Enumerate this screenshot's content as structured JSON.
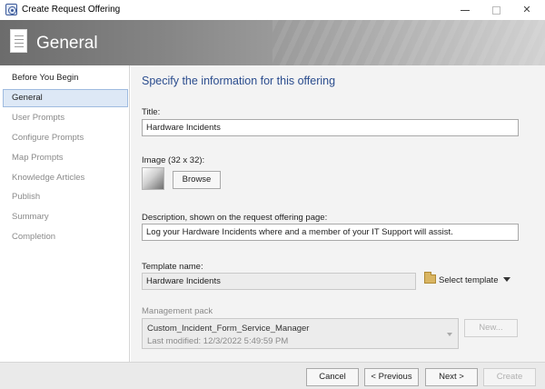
{
  "window": {
    "title": "Create Request Offering",
    "minimize_label": "—",
    "close_label": "✕"
  },
  "header": {
    "title": "General"
  },
  "sidebar": {
    "items": [
      {
        "label": "Before You Begin"
      },
      {
        "label": "General"
      },
      {
        "label": "User Prompts"
      },
      {
        "label": "Configure Prompts"
      },
      {
        "label": "Map Prompts"
      },
      {
        "label": "Knowledge Articles"
      },
      {
        "label": "Publish"
      },
      {
        "label": "Summary"
      },
      {
        "label": "Completion"
      }
    ],
    "active_index": 1
  },
  "main": {
    "section_title": "Specify the information for this offering",
    "title_label": "Title:",
    "title_value": "Hardware Incidents",
    "image_label": "Image (32 x 32):",
    "browse_label": "Browse",
    "description_label": "Description, shown on the request offering page:",
    "description_value": "Log your Hardware Incidents where and a member of your IT Support will assist.",
    "template_label": "Template name:",
    "template_value": "Hardware Incidents",
    "select_template_label": "Select template",
    "management_pack_label": "Management pack",
    "management_pack_name": "Custom_Incident_Form_Service_Manager",
    "management_pack_modified": "Last modified:  12/3/2022 5:49:59 PM",
    "new_label": "New..."
  },
  "footer": {
    "cancel_label": "Cancel",
    "previous_label": "< Previous",
    "next_label": "Next >",
    "create_label": "Create"
  },
  "colors": {
    "accent_title": "#2b4d8e",
    "nav_active_bg": "#dde8f6",
    "nav_active_border": "#9fbbe0"
  }
}
